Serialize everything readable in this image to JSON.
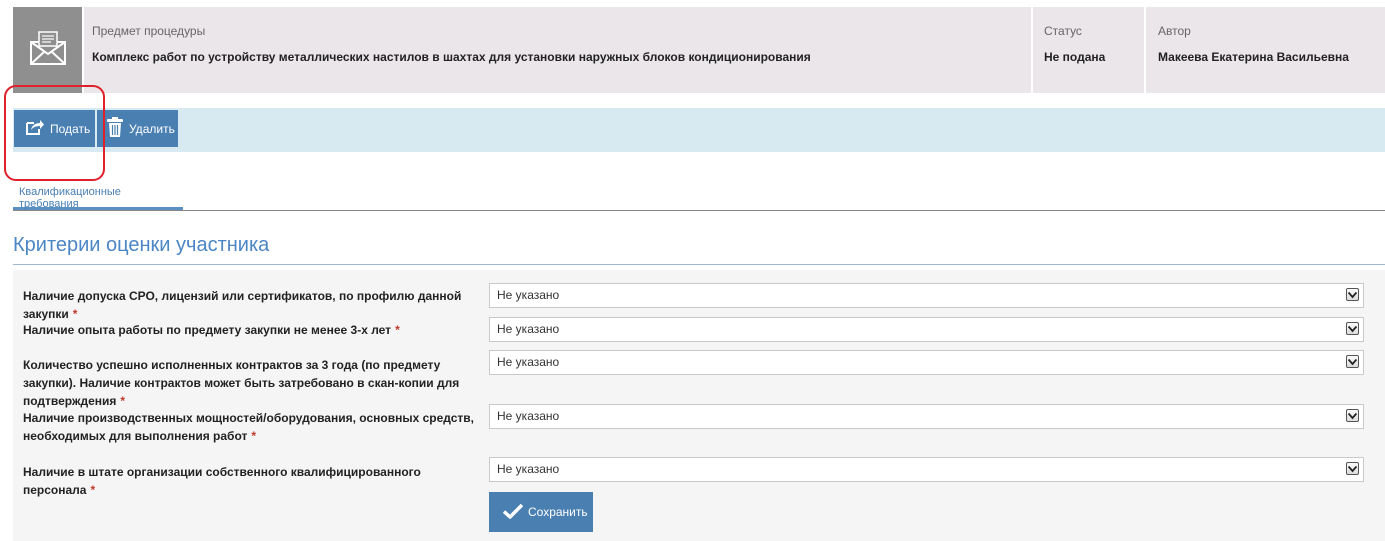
{
  "header": {
    "subject_label": "Предмет процедуры",
    "subject_value": "Комплекс работ по устройству металлических настилов в шахтах для установки наружных блоков кондиционирования",
    "status_label": "Статус",
    "status_value": "Не подана",
    "author_label": "Автор",
    "author_value": "Макеева Екатерина Васильевна",
    "icon": "envelope-icon"
  },
  "toolbar": {
    "submit_label": "Подать",
    "submit_icon": "share-icon",
    "delete_label": "Удалить",
    "delete_icon": "trash-icon"
  },
  "tabs": [
    {
      "label": "Квалификационные требования",
      "active": true
    }
  ],
  "section": {
    "title": "Критерии оценки участника"
  },
  "criteria": [
    {
      "label": "Наличие допуска СРО, лицензий или сертификатов, по профилю данной закупки",
      "required": "*",
      "value": "Не указано"
    },
    {
      "label": "Наличие опыта работы по предмету закупки не менее 3-х лет",
      "required": "*",
      "value": "Не указано"
    },
    {
      "label": "Количество успешно исполненных контрактов за 3 года (по предмету закупки). Наличие контрактов может быть затребовано в скан-копии для подтверждения",
      "required": "*",
      "value": "Не указано"
    },
    {
      "label": "Наличие производственных мощностей/оборудования, основных средств, необходимых для выполнения работ",
      "required": "*",
      "value": "Не указано"
    },
    {
      "label": "Наличие в штате организации собственного квалифицированного персонала",
      "required": "*",
      "value": "Не указано"
    }
  ],
  "save": {
    "label": "Сохранить",
    "icon": "checkmark-icon"
  },
  "colors": {
    "accent": "#4a7fb2",
    "header_bg": "#ebe6ea",
    "toolbar_bg": "#d7eaf2",
    "highlight": "#e0202a",
    "required": "#c0392b"
  }
}
